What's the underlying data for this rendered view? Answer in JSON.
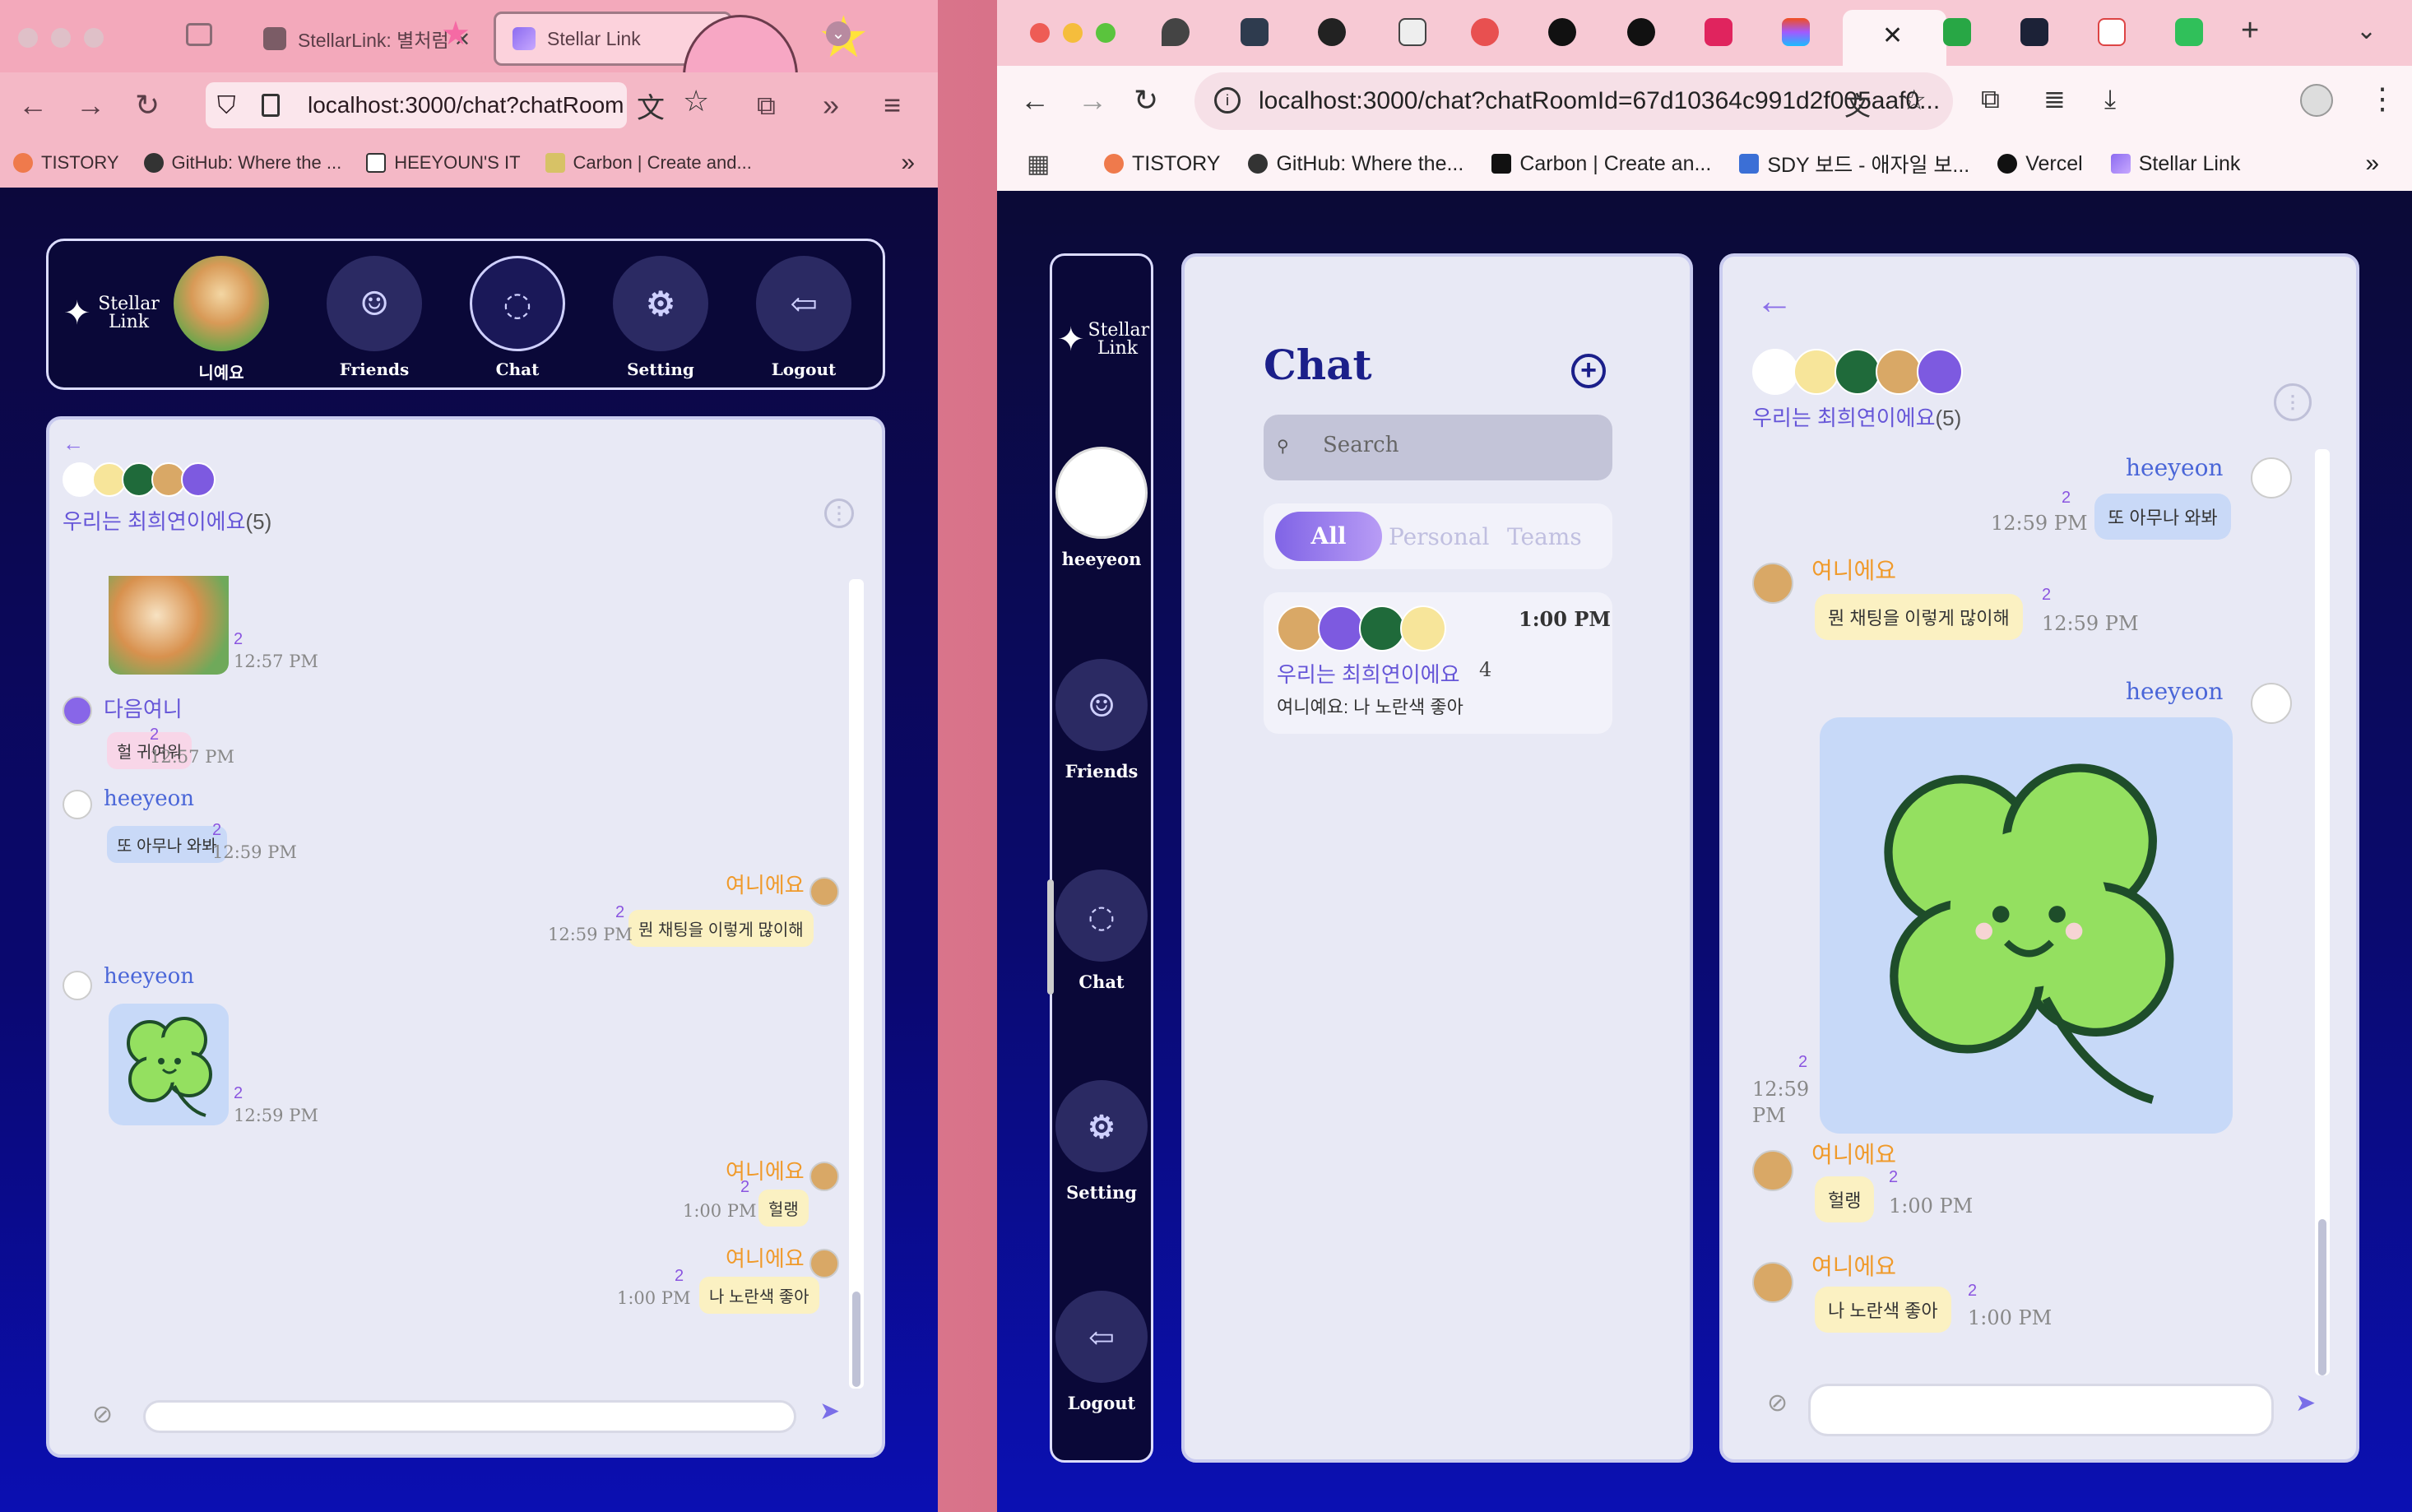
{
  "left_browser": {
    "tabs": [
      {
        "label": "StellarLink: 별처럼"
      },
      {
        "label": "Stellar Link"
      }
    ],
    "url": "localhost:3000/chat?chatRoom",
    "bookmarks": [
      "TISTORY",
      "GitHub: Where the ...",
      "HEEYOUN'S IT",
      "Carbon | Create and..."
    ],
    "nav": {
      "logo": "Stellar Link",
      "profile_name": "니예요",
      "items": [
        "Friends",
        "Chat",
        "Setting",
        "Logout"
      ]
    },
    "chat": {
      "room_name": "우리는 최희연이에요",
      "member_count": "(5)",
      "messages": [
        {
          "type": "image",
          "unread": "2",
          "time": "12:57 PM"
        },
        {
          "sender": "다음여니",
          "text": "헐 귀여워",
          "unread": "2",
          "time": "12:57 PM"
        },
        {
          "sender": "heeyeon",
          "text": "또 아무나 와봐",
          "unread": "2",
          "time": "12:59 PM"
        },
        {
          "sender": "여니에요",
          "text": "뭔 채팅을 이렇게 많이해",
          "unread": "2",
          "time": "12:59 PM"
        },
        {
          "sender": "heeyeon",
          "type": "image",
          "unread": "2",
          "time": "12:59 PM"
        },
        {
          "sender": "여니에요",
          "text": "헐랭",
          "unread": "2",
          "time": "1:00 PM"
        },
        {
          "sender": "여니에요",
          "text": "나 노란색 좋아",
          "unread": "2",
          "time": "1:00 PM"
        }
      ]
    }
  },
  "right_browser": {
    "url": "localhost:3000/chat?chatRoomId=67d10364c991d2f005aaf0...",
    "bookmarks": [
      "TISTORY",
      "GitHub: Where the...",
      "Carbon | Create an...",
      "SDY 보드 - 애자일 보...",
      "Vercel",
      "Stellar Link"
    ],
    "sidebar": {
      "logo": "Stellar Link",
      "profile_name": "heeyeon",
      "items": [
        "Friends",
        "Chat",
        "Setting",
        "Logout"
      ]
    },
    "chat_list": {
      "title": "Chat",
      "search_placeholder": "Search",
      "filters": [
        "All",
        "Personal",
        "Teams"
      ],
      "rooms": [
        {
          "name": "우리는 최희연이에요",
          "count": "4",
          "time": "1:00 PM",
          "preview": "여니예요: 나 노란색 좋아"
        }
      ]
    },
    "conversation": {
      "room_name": "우리는 최희연이에요",
      "member_count": "(5)",
      "messages": [
        {
          "sender": "heeyeon",
          "text": "또 아무나 와봐",
          "unread": "2",
          "time": "12:59 PM"
        },
        {
          "sender": "여니에요",
          "text": "뭔 채팅을 이렇게 많이해",
          "unread": "2",
          "time": "12:59 PM"
        },
        {
          "sender": "heeyeon",
          "type": "image",
          "unread": "2",
          "time_line1": "12:59",
          "time_line2": "PM"
        },
        {
          "sender": "여니에요",
          "text": "헐랭",
          "unread": "2",
          "time": "1:00 PM"
        },
        {
          "sender": "여니에요",
          "text": "나 노란색 좋아",
          "unread": "2",
          "time": "1:00 PM"
        }
      ]
    }
  },
  "colors": {
    "accent": "#6656d8",
    "orange_name": "#f09a2a",
    "blue_name": "#4a66d8",
    "chat_title": "#1b1f8a"
  }
}
